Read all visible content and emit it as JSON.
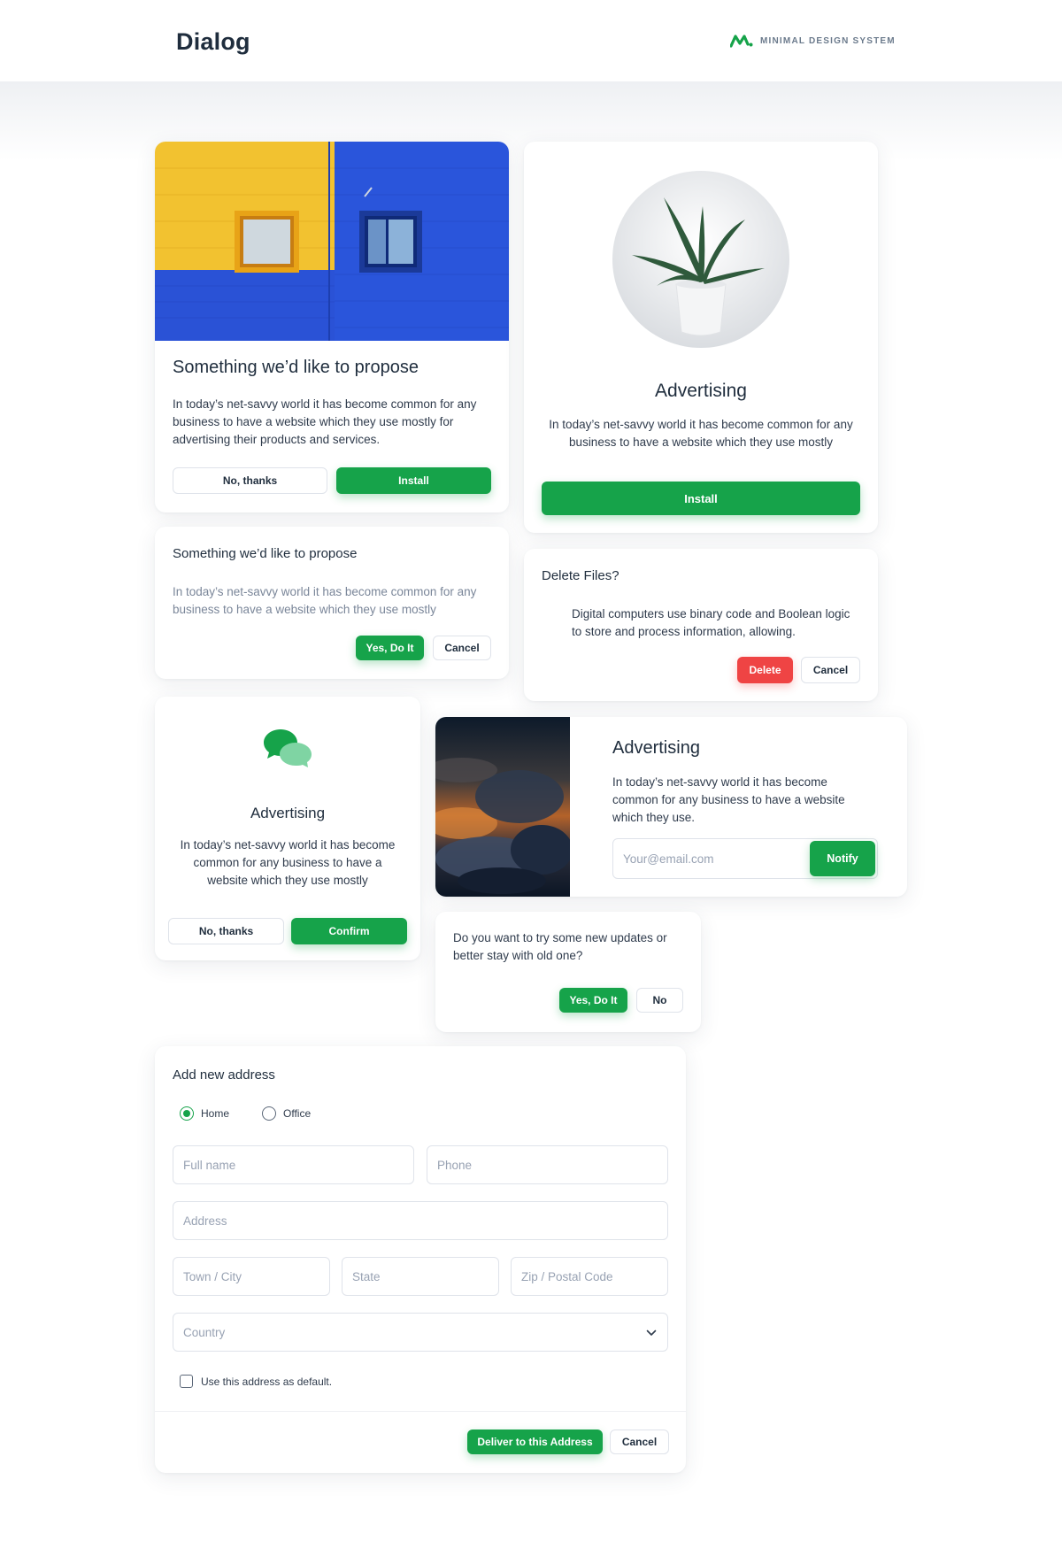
{
  "header": {
    "title": "Dialog",
    "brand": "MINIMAL DESIGN SYSTEM"
  },
  "card1": {
    "title": "Something we’d like to propose",
    "body": "In today’s net-savvy world it has become common for any business to have a website which they use mostly for advertising their products and services.",
    "secondary_label": "No, thanks",
    "primary_label": "Install"
  },
  "card2": {
    "title": "Advertising",
    "body": "In today’s net-savvy world it has become common for any business to have a website which they use mostly",
    "primary_label": "Install"
  },
  "card3": {
    "title": "Something we’d like to propose",
    "body": "In today’s net-savvy world it has become common for any business to have a website which they use mostly",
    "primary_label": "Yes, Do It",
    "secondary_label": "Cancel"
  },
  "card4": {
    "title": "Delete Files?",
    "body": "Digital computers use binary code and Boolean logic to store and process information, allowing.",
    "danger_label": "Delete",
    "secondary_label": "Cancel"
  },
  "card5": {
    "title": "Advertising",
    "body": "In today’s net-savvy world it has become common for any business to have a website which they use mostly",
    "secondary_label": "No, thanks",
    "primary_label": "Confirm"
  },
  "card6": {
    "title": "Advertising",
    "body": "In today’s net-savvy world it has become common for any business to have a website which they use.",
    "email_placeholder": "Your@email.com",
    "primary_label": "Notify"
  },
  "card7": {
    "body": "Do you want to try some new updates or better stay with old one?",
    "primary_label": "Yes, Do It",
    "secondary_label": "No"
  },
  "address_form": {
    "title": "Add new address",
    "radio_home": "Home",
    "radio_office": "Office",
    "selected": "Home",
    "full_name_placeholder": "Full name",
    "phone_placeholder": "Phone",
    "address_placeholder": "Address",
    "city_placeholder": "Town / City",
    "state_placeholder": "State",
    "zip_placeholder": "Zip / Postal Code",
    "country_placeholder": "Country",
    "default_checkbox_label": "Use this address as default.",
    "primary_label": "Deliver to this Address",
    "secondary_label": "Cancel"
  },
  "colors": {
    "accent": "#16a34a",
    "danger": "#ef4444",
    "text": "#1f2d3d",
    "border": "#dfe3ea"
  }
}
